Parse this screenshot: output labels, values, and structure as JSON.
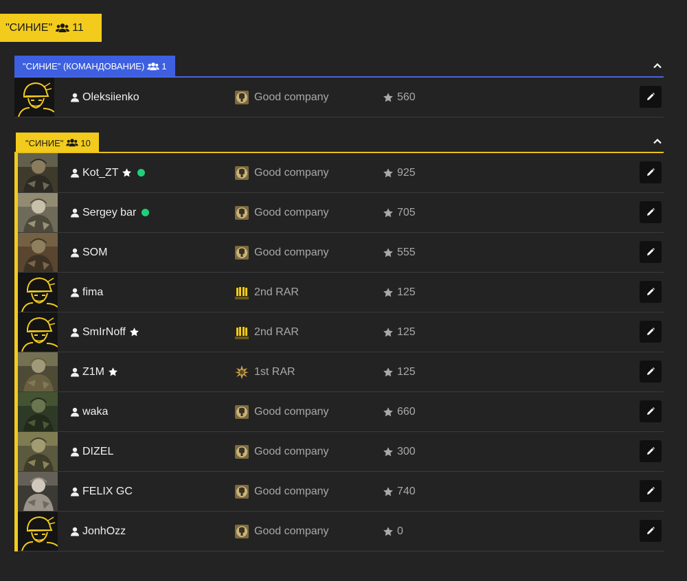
{
  "team": {
    "name": "\"СИНИЕ\"",
    "count": "11"
  },
  "groups": [
    {
      "id": "cmd",
      "name": "\"СИНИЕ\" (КОМАНДОВАНИЕ)",
      "count": "1",
      "color": "#3d5fe0",
      "members": [
        {
          "name": "Oleksiienko",
          "starred": false,
          "online": false,
          "unit": "Good company",
          "unit_icon": "good-company",
          "score": "560",
          "avatar": "emblem"
        }
      ]
    },
    {
      "id": "main",
      "name": "\"СИНИЕ\"",
      "count": "10",
      "color": "#f2cb1d",
      "members": [
        {
          "name": "Kot_ZT",
          "starred": true,
          "online": true,
          "unit": "Good company",
          "unit_icon": "good-company",
          "score": "925",
          "avatar": "photo-forest"
        },
        {
          "name": "Sergey bar",
          "starred": false,
          "online": true,
          "unit": "Good company",
          "unit_icon": "good-company",
          "score": "705",
          "avatar": "photo-camo"
        },
        {
          "name": "SOM",
          "starred": false,
          "online": false,
          "unit": "Good company",
          "unit_icon": "good-company",
          "score": "555",
          "avatar": "photo-field"
        },
        {
          "name": "fima",
          "starred": false,
          "online": false,
          "unit": "2nd RAR",
          "unit_icon": "2nd-rar",
          "score": "125",
          "avatar": "emblem"
        },
        {
          "name": "SmIrNoff",
          "starred": true,
          "online": false,
          "unit": "2nd RAR",
          "unit_icon": "2nd-rar",
          "score": "125",
          "avatar": "emblem"
        },
        {
          "name": "Z1M",
          "starred": true,
          "online": false,
          "unit": "1st RAR",
          "unit_icon": "1st-rar",
          "score": "125",
          "avatar": "photo-ghillie"
        },
        {
          "name": "waka",
          "starred": false,
          "online": false,
          "unit": "Good company",
          "unit_icon": "good-company",
          "score": "660",
          "avatar": "photo-green"
        },
        {
          "name": "DIZEL",
          "starred": false,
          "online": false,
          "unit": "Good company",
          "unit_icon": "good-company",
          "score": "300",
          "avatar": "photo-multicam"
        },
        {
          "name": "FELIX GC",
          "starred": false,
          "online": false,
          "unit": "Good company",
          "unit_icon": "good-company",
          "score": "740",
          "avatar": "photo-hat"
        },
        {
          "name": "JonhOzz",
          "starred": false,
          "online": false,
          "unit": "Good company",
          "unit_icon": "good-company",
          "score": "0",
          "avatar": "emblem"
        }
      ]
    }
  ]
}
